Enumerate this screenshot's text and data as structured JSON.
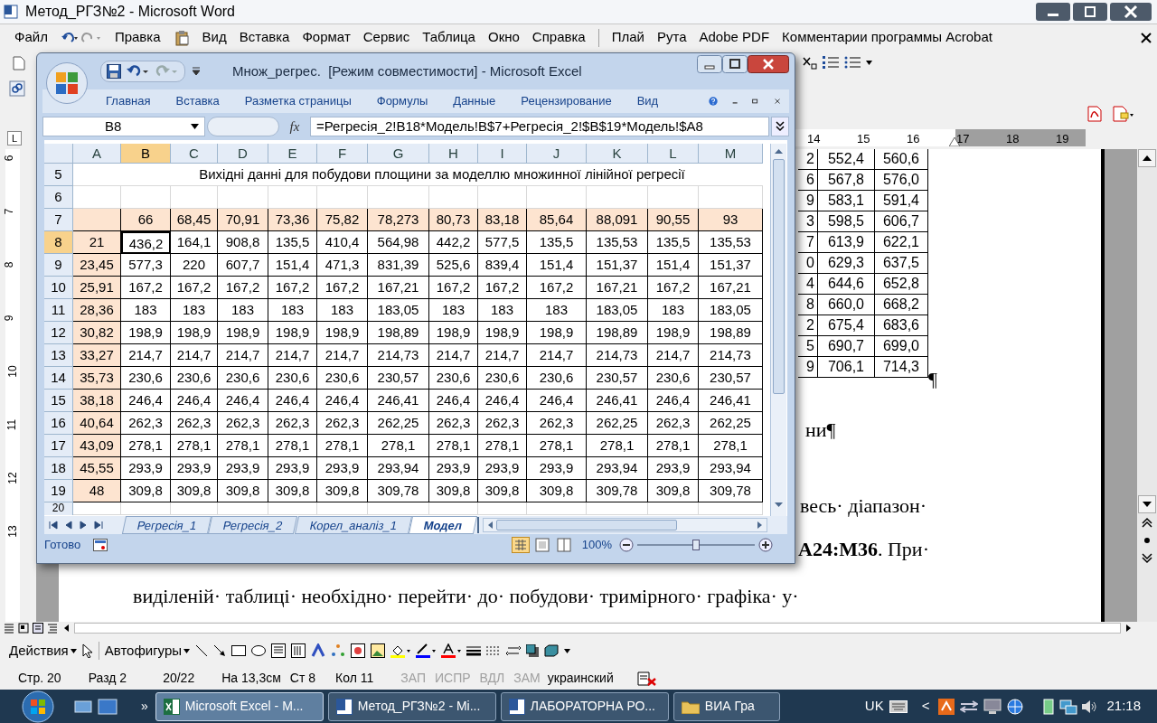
{
  "word": {
    "title": "Метод_РГЗ№2 - Microsoft Word",
    "menu": [
      {
        "kind": "item",
        "label": "Файл"
      },
      {
        "kind": "undo"
      },
      {
        "kind": "item",
        "label": "Правка"
      },
      {
        "kind": "icon"
      },
      {
        "kind": "item",
        "label": "Вид"
      },
      {
        "kind": "item",
        "label": "Вставка"
      },
      {
        "kind": "item",
        "label": "Формат"
      },
      {
        "kind": "item",
        "label": "Сервис"
      },
      {
        "kind": "item",
        "label": "Таблица"
      },
      {
        "kind": "item",
        "label": "Окно"
      },
      {
        "kind": "item",
        "label": "Справка"
      },
      {
        "kind": "separator"
      },
      {
        "kind": "item",
        "label": "Плай"
      },
      {
        "kind": "item",
        "label": "Рута"
      },
      {
        "kind": "item",
        "label": "Adobe PDF"
      },
      {
        "kind": "item",
        "label": "Комментарии программы Acrobat"
      }
    ],
    "tab_selector": "L",
    "ruler_numbers": [
      "14",
      "15",
      "16",
      "17",
      "18",
      "19"
    ],
    "vertical_ruler": [
      "6",
      "7",
      "8",
      "9",
      "10",
      "11",
      "12",
      "13"
    ],
    "table_rows": [
      {
        "partial": "2",
        "c1": "552,4",
        "c2": "560,6"
      },
      {
        "partial": "6",
        "c1": "567,8",
        "c2": "576,0"
      },
      {
        "partial": "9",
        "c1": "583,1",
        "c2": "591,4"
      },
      {
        "partial": "3",
        "c1": "598,5",
        "c2": "606,7"
      },
      {
        "partial": "7",
        "c1": "613,9",
        "c2": "622,1"
      },
      {
        "partial": "0",
        "c1": "629,3",
        "c2": "637,5"
      },
      {
        "partial": "4",
        "c1": "644,6",
        "c2": "652,8"
      },
      {
        "partial": "8",
        "c1": "660,0",
        "c2": "668,2"
      },
      {
        "partial": "2",
        "c1": "675,4",
        "c2": "683,6"
      },
      {
        "partial": "5",
        "c1": "690,7",
        "c2": "699,0"
      },
      {
        "partial": "9",
        "c1": "706,1",
        "c2": "714,3"
      }
    ],
    "pilcrow": "¶",
    "doc_lines": [
      "ни¶",
      "весь· діапазон·",
      "**A24:M36**. При·",
      "виділеній· таблиці· необхідно· перейти· до· побудови· тримірного· графіка· у·"
    ],
    "drawing_toolbar": {
      "actions": "Действия",
      "autoshapes": "Автофигуры"
    },
    "status": [
      {
        "text": "Стр. 20",
        "disabled": false
      },
      {
        "text": "Разд 2",
        "disabled": false
      },
      {
        "text": "20/22",
        "disabled": false
      },
      {
        "text": "На 13,3см",
        "disabled": false
      },
      {
        "text": "Ст 8",
        "disabled": false
      },
      {
        "text": "Кол 11",
        "disabled": false
      },
      {
        "text": "ЗАП",
        "disabled": true
      },
      {
        "text": "ИСПР",
        "disabled": true
      },
      {
        "text": "ВДЛ",
        "disabled": true
      },
      {
        "text": "ЗАМ",
        "disabled": true
      },
      {
        "text": "украинский",
        "disabled": false
      }
    ]
  },
  "excel": {
    "title": "Множ_регрес.  [Режим совместимости] - Microsoft Excel",
    "ribbon_tabs": [
      "Главная",
      "Вставка",
      "Разметка страницы",
      "Формулы",
      "Данные",
      "Рецензирование",
      "Вид"
    ],
    "name_box": "B8",
    "formula": "=Регресія_2!B18*Модель!B$7+Регресія_2!$B$19*Модель!$A8",
    "columns": [
      {
        "label": "A",
        "selected": false
      },
      {
        "label": "B",
        "selected": true
      },
      {
        "label": "C",
        "selected": false
      },
      {
        "label": "D",
        "selected": false
      },
      {
        "label": "E",
        "selected": false
      },
      {
        "label": "F",
        "selected": false
      },
      {
        "label": "G",
        "selected": false
      },
      {
        "label": "H",
        "selected": false
      },
      {
        "label": "I",
        "selected": false
      },
      {
        "label": "J",
        "selected": false
      },
      {
        "label": "K",
        "selected": false
      },
      {
        "label": "L",
        "selected": false
      },
      {
        "label": "M",
        "selected": false
      }
    ],
    "rows": [
      {
        "header": "5",
        "kind": "title",
        "selected": false,
        "text": "Вихідні данні для побудови площини за моделлю множинної лінійної регресії"
      },
      {
        "header": "6",
        "kind": "empty",
        "selected": false
      },
      {
        "header": "7",
        "kind": "header",
        "selected": false,
        "cells": [
          "",
          "66",
          "68,45",
          "70,91",
          "73,36",
          "75,82",
          "78,273",
          "80,73",
          "83,18",
          "85,64",
          "88,091",
          "90,55",
          "93"
        ]
      },
      {
        "header": "8",
        "kind": "data",
        "selected": true,
        "cells": [
          "21",
          "436,2",
          "164,1",
          "908,8",
          "135,5",
          "410,4",
          "564,98",
          "442,2",
          "577,5",
          "135,5",
          "135,53",
          "135,5",
          "135,53"
        ]
      },
      {
        "header": "9",
        "kind": "data",
        "selected": false,
        "cells": [
          "23,45",
          "577,3",
          "220",
          "607,7",
          "151,4",
          "471,3",
          "831,39",
          "525,6",
          "839,4",
          "151,4",
          "151,37",
          "151,4",
          "151,37"
        ]
      },
      {
        "header": "10",
        "kind": "data",
        "selected": false,
        "cells": [
          "25,91",
          "167,2",
          "167,2",
          "167,2",
          "167,2",
          "167,2",
          "167,21",
          "167,2",
          "167,2",
          "167,2",
          "167,21",
          "167,2",
          "167,21"
        ]
      },
      {
        "header": "11",
        "kind": "data",
        "selected": false,
        "cells": [
          "28,36",
          "183",
          "183",
          "183",
          "183",
          "183",
          "183,05",
          "183",
          "183",
          "183",
          "183,05",
          "183",
          "183,05"
        ]
      },
      {
        "header": "12",
        "kind": "data",
        "selected": false,
        "cells": [
          "30,82",
          "198,9",
          "198,9",
          "198,9",
          "198,9",
          "198,9",
          "198,89",
          "198,9",
          "198,9",
          "198,9",
          "198,89",
          "198,9",
          "198,89"
        ]
      },
      {
        "header": "13",
        "kind": "data",
        "selected": false,
        "cells": [
          "33,27",
          "214,7",
          "214,7",
          "214,7",
          "214,7",
          "214,7",
          "214,73",
          "214,7",
          "214,7",
          "214,7",
          "214,73",
          "214,7",
          "214,73"
        ]
      },
      {
        "header": "14",
        "kind": "data",
        "selected": false,
        "cells": [
          "35,73",
          "230,6",
          "230,6",
          "230,6",
          "230,6",
          "230,6",
          "230,57",
          "230,6",
          "230,6",
          "230,6",
          "230,57",
          "230,6",
          "230,57"
        ]
      },
      {
        "header": "15",
        "kind": "data",
        "selected": false,
        "cells": [
          "38,18",
          "246,4",
          "246,4",
          "246,4",
          "246,4",
          "246,4",
          "246,41",
          "246,4",
          "246,4",
          "246,4",
          "246,41",
          "246,4",
          "246,41"
        ]
      },
      {
        "header": "16",
        "kind": "data",
        "selected": false,
        "cells": [
          "40,64",
          "262,3",
          "262,3",
          "262,3",
          "262,3",
          "262,3",
          "262,25",
          "262,3",
          "262,3",
          "262,3",
          "262,25",
          "262,3",
          "262,25"
        ]
      },
      {
        "header": "17",
        "kind": "data",
        "selected": false,
        "cells": [
          "43,09",
          "278,1",
          "278,1",
          "278,1",
          "278,1",
          "278,1",
          "278,1",
          "278,1",
          "278,1",
          "278,1",
          "278,1",
          "278,1",
          "278,1"
        ]
      },
      {
        "header": "18",
        "kind": "data",
        "selected": false,
        "cells": [
          "45,55",
          "293,9",
          "293,9",
          "293,9",
          "293,9",
          "293,9",
          "293,94",
          "293,9",
          "293,9",
          "293,9",
          "293,94",
          "293,9",
          "293,94"
        ]
      },
      {
        "header": "19",
        "kind": "data",
        "selected": false,
        "cells": [
          "48",
          "309,8",
          "309,8",
          "309,8",
          "309,8",
          "309,8",
          "309,78",
          "309,8",
          "309,8",
          "309,8",
          "309,78",
          "309,8",
          "309,78"
        ]
      },
      {
        "header": "20",
        "kind": "empty",
        "selected": false
      }
    ],
    "sheet_tabs": [
      {
        "label": "Регресія_1",
        "selected": false
      },
      {
        "label": "Регресія_2",
        "selected": false
      },
      {
        "label": "Корел_аналіз_1",
        "selected": false
      },
      {
        "label": "Модел",
        "selected": true
      }
    ],
    "status": "Готово",
    "zoom": "100%",
    "zoom_slider": {
      "level": 0.5
    },
    "function_button": "fx"
  },
  "taskbar": {
    "more": "»",
    "tasks": [
      {
        "label": "Microsoft Excel - M...",
        "kind": "excel",
        "selected": true
      },
      {
        "label": "Метод_РГЗ№2 - Mi...",
        "kind": "word",
        "selected": false
      },
      {
        "label": "ЛАБОРАТОРНА РО...",
        "kind": "word",
        "selected": false
      },
      {
        "label": "ВИА Гра",
        "kind": "folder",
        "selected": false
      }
    ],
    "language": "UK",
    "tray_arrow": "<",
    "time": "21:18"
  }
}
